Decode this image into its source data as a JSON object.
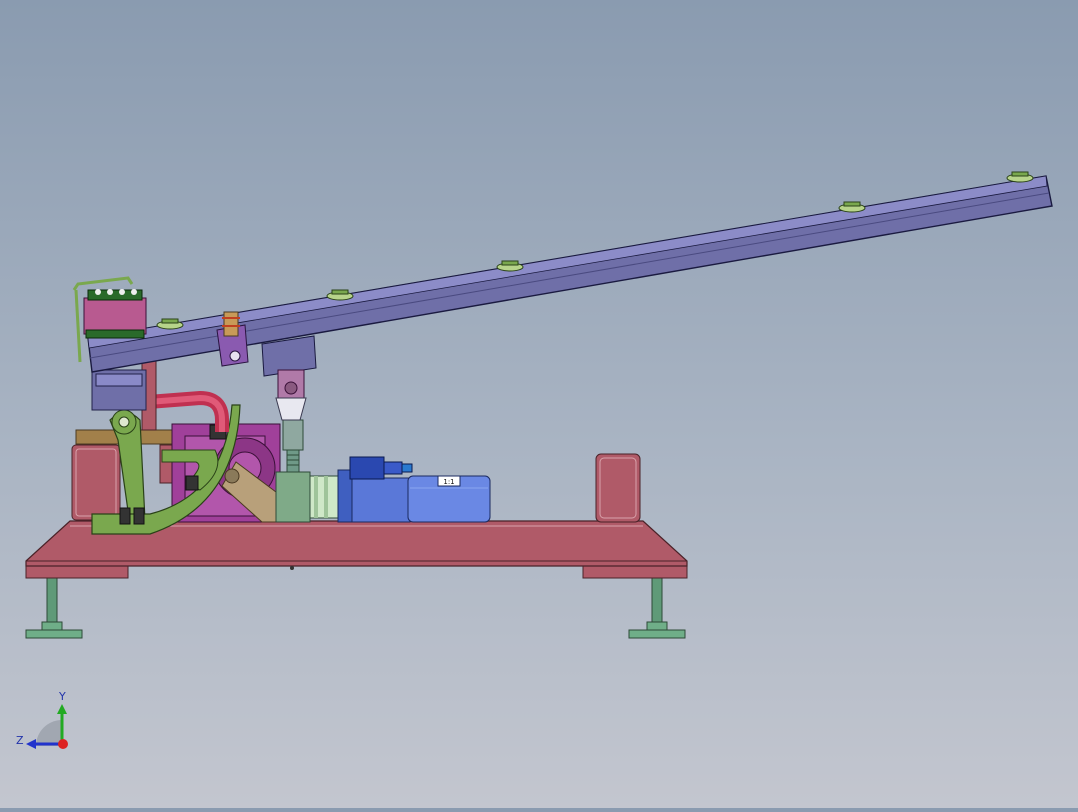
{
  "viewport": {
    "background_top": "#8a9bb0",
    "background_bottom": "#c3c6cf"
  },
  "model": {
    "base_color": "#b05a68",
    "beam_color": "#6f6fa8",
    "arm_color": "#7aa84e",
    "motor_color": "#5a78d8",
    "gearbox_color": "#a0409a",
    "leg_color": "#5f9a78",
    "motor_label": "1:1"
  },
  "triad": {
    "y_label": "Y",
    "z_label": "Z",
    "y_color": "#22aa22",
    "z_color": "#2233cc",
    "x_color": "#dd2222"
  }
}
